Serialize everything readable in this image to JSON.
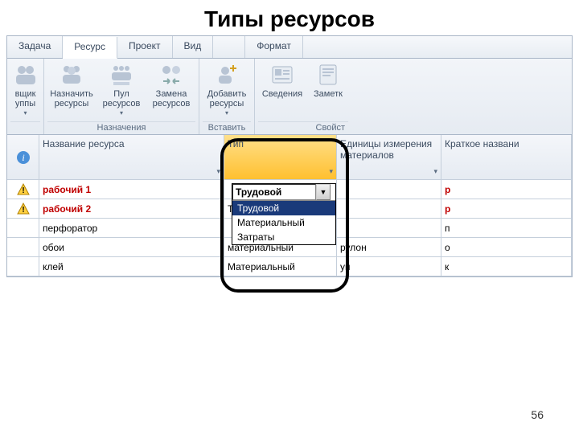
{
  "slide_title": "Типы ресурсов",
  "page_number": "56",
  "tabs": {
    "task": "Задача",
    "resource": "Ресурс",
    "project": "Проект",
    "view": "Вид",
    "format": "Формат"
  },
  "ribbon": {
    "col0_line1": "вщик",
    "col0_line2": "уппы",
    "assignments": {
      "label": "Назначения",
      "assign": {
        "line1": "Назначить",
        "line2": "ресурсы"
      },
      "pool": {
        "line1": "Пул",
        "line2": "ресурсов"
      },
      "replace": {
        "line1": "Замена",
        "line2": "ресурсов"
      }
    },
    "insert": {
      "label": "Вставить",
      "add": {
        "line1": "Добавить",
        "line2": "ресурсы"
      }
    },
    "properties": {
      "label": "Свойст",
      "info": "Сведения",
      "notes": "Заметк"
    }
  },
  "headers": {
    "indicator": "",
    "name": "Название ресурса",
    "type": "Тип",
    "units": "Единицы измерения материалов",
    "short": "Краткое названи"
  },
  "rows": [
    {
      "warn": true,
      "name": "рабочий 1",
      "type": "",
      "unit": "",
      "short": "р",
      "red": true
    },
    {
      "warn": true,
      "name": "рабочий 2",
      "type": "Трудовой",
      "unit": "",
      "short": "р",
      "red": true
    },
    {
      "warn": false,
      "name": "перфоратор",
      "type": "",
      "unit": "",
      "short": "п",
      "red": false
    },
    {
      "warn": false,
      "name": "обои",
      "type": "материальный",
      "unit": "рулон",
      "short": "о",
      "red": false
    },
    {
      "warn": false,
      "name": "клей",
      "type": "Материальный",
      "unit": "уп",
      "short": "к",
      "red": false
    }
  ],
  "combo": {
    "value": "Трудовой",
    "opt0": "Трудовой",
    "opt1": "Материальный",
    "opt2": "Затраты"
  }
}
